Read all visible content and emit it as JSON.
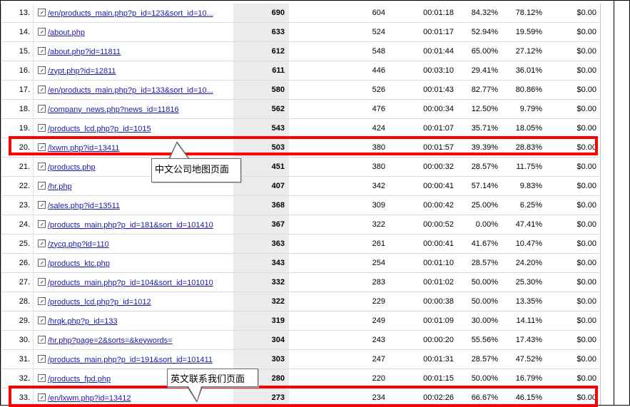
{
  "rows": [
    {
      "num": "13.",
      "page": "/en/products_main.php?p_id=123&sort_id=10...",
      "views": "690",
      "uv": "604",
      "time": "00:01:18",
      "pct1": "84.32%",
      "pct2": "78.12%",
      "money": "$0.00"
    },
    {
      "num": "14.",
      "page": "/about.php",
      "views": "633",
      "uv": "524",
      "time": "00:01:17",
      "pct1": "52.94%",
      "pct2": "19.59%",
      "money": "$0.00"
    },
    {
      "num": "15.",
      "page": "/about.php?id=11811",
      "views": "612",
      "uv": "548",
      "time": "00:01:44",
      "pct1": "65.00%",
      "pct2": "27.12%",
      "money": "$0.00"
    },
    {
      "num": "16.",
      "page": "/zypt.php?id=12811",
      "views": "611",
      "uv": "446",
      "time": "00:03:10",
      "pct1": "29.41%",
      "pct2": "36.01%",
      "money": "$0.00"
    },
    {
      "num": "17.",
      "page": "/en/products_main.php?p_id=133&sort_id=10...",
      "views": "580",
      "uv": "526",
      "time": "00:01:43",
      "pct1": "82.77%",
      "pct2": "80.86%",
      "money": "$0.00"
    },
    {
      "num": "18.",
      "page": "/company_news.php?news_id=11816",
      "views": "562",
      "uv": "476",
      "time": "00:00:34",
      "pct1": "12.50%",
      "pct2": "9.79%",
      "money": "$0.00"
    },
    {
      "num": "19.",
      "page": "/products_lcd.php?p_id=1015",
      "views": "543",
      "uv": "424",
      "time": "00:01:07",
      "pct1": "35.71%",
      "pct2": "18.05%",
      "money": "$0.00"
    },
    {
      "num": "20.",
      "page": "/lxwm.php?id=13411",
      "views": "503",
      "uv": "380",
      "time": "00:01:57",
      "pct1": "39.39%",
      "pct2": "28.83%",
      "money": "$0.00"
    },
    {
      "num": "21.",
      "page": "/products.php",
      "views": "451",
      "uv": "380",
      "time": "00:00:32",
      "pct1": "28.57%",
      "pct2": "11.75%",
      "money": "$0.00"
    },
    {
      "num": "22.",
      "page": "/hr.php",
      "views": "407",
      "uv": "342",
      "time": "00:00:41",
      "pct1": "57.14%",
      "pct2": "9.83%",
      "money": "$0.00"
    },
    {
      "num": "23.",
      "page": "/sales.php?id=13511",
      "views": "368",
      "uv": "309",
      "time": "00:00:42",
      "pct1": "25.00%",
      "pct2": "6.25%",
      "money": "$0.00"
    },
    {
      "num": "24.",
      "page": "/products_main.php?p_id=181&sort_id=101410",
      "views": "367",
      "uv": "322",
      "time": "00:00:52",
      "pct1": "0.00%",
      "pct2": "47.41%",
      "money": "$0.00"
    },
    {
      "num": "25.",
      "page": "/zycq.php?id=110",
      "views": "363",
      "uv": "261",
      "time": "00:00:41",
      "pct1": "41.67%",
      "pct2": "10.47%",
      "money": "$0.00"
    },
    {
      "num": "26.",
      "page": "/products_ktc.php",
      "views": "343",
      "uv": "254",
      "time": "00:01:10",
      "pct1": "28.57%",
      "pct2": "24.20%",
      "money": "$0.00"
    },
    {
      "num": "27.",
      "page": "/products_main.php?p_id=104&sort_id=101010",
      "views": "332",
      "uv": "283",
      "time": "00:01:02",
      "pct1": "50.00%",
      "pct2": "25.30%",
      "money": "$0.00"
    },
    {
      "num": "28.",
      "page": "/products_lcd.php?p_id=1012",
      "views": "322",
      "uv": "229",
      "time": "00:00:38",
      "pct1": "50.00%",
      "pct2": "13.35%",
      "money": "$0.00"
    },
    {
      "num": "29.",
      "page": "/hrqk.php?p_id=133",
      "views": "319",
      "uv": "249",
      "time": "00:01:09",
      "pct1": "30.00%",
      "pct2": "14.11%",
      "money": "$0.00"
    },
    {
      "num": "30.",
      "page": "/hr.php?page=2&sorts=&keywords=",
      "views": "304",
      "uv": "243",
      "time": "00:00:20",
      "pct1": "55.56%",
      "pct2": "17.43%",
      "money": "$0.00"
    },
    {
      "num": "31.",
      "page": "/products_main.php?p_id=191&sort_id=101411",
      "views": "303",
      "uv": "247",
      "time": "00:01:31",
      "pct1": "28.57%",
      "pct2": "47.52%",
      "money": "$0.00"
    },
    {
      "num": "32.",
      "page": "/products_fpd.php",
      "views": "280",
      "uv": "220",
      "time": "00:01:15",
      "pct1": "50.00%",
      "pct2": "16.79%",
      "money": "$0.00"
    },
    {
      "num": "33.",
      "page": "/en/lxwm.php?id=13412",
      "views": "273",
      "uv": "234",
      "time": "00:02:26",
      "pct1": "66.67%",
      "pct2": "46.15%",
      "money": "$0.00"
    }
  ],
  "annotations": {
    "callout_cn_map": "中文公司地图页面",
    "callout_en_contact": "英文联系我们页面",
    "highlight_color": "#ff0000"
  },
  "icons": {
    "row_link_icon": "external-link-icon"
  }
}
